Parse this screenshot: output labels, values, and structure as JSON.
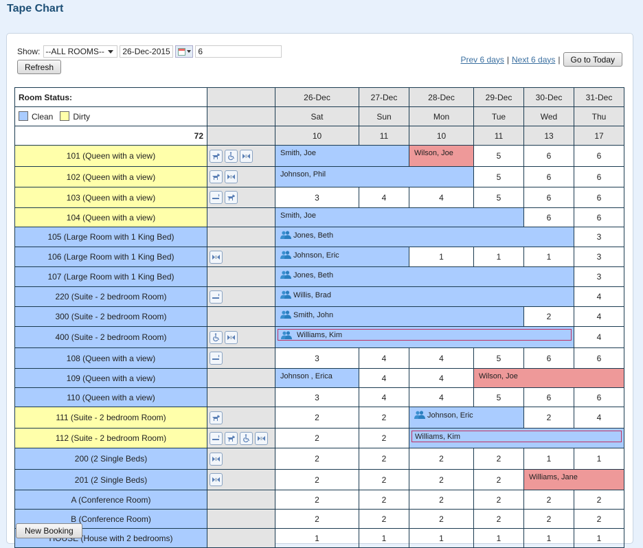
{
  "page": {
    "title": "Tape Chart"
  },
  "controls": {
    "show_label": "Show:",
    "room_filter": "--ALL ROOMS--",
    "start_date": "26-Dec-2015",
    "days": "6",
    "refresh_label": "Refresh",
    "prev_label": "Prev 6 days",
    "next_label": "Next 6 days",
    "separator": "|",
    "today_label": "Go to Today"
  },
  "legend": {
    "room_status_label": "Room Status:",
    "clean_label": "Clean",
    "dirty_label": "Dirty",
    "clean_color": "#aaccff",
    "dirty_color": "#ffffaa",
    "total": "72"
  },
  "days": [
    {
      "date": "26-Dec",
      "dow": "Sat",
      "avail": "10"
    },
    {
      "date": "27-Dec",
      "dow": "Sun",
      "avail": "11"
    },
    {
      "date": "28-Dec",
      "dow": "Mon",
      "avail": "10"
    },
    {
      "date": "29-Dec",
      "dow": "Tue",
      "avail": "11"
    },
    {
      "date": "30-Dec",
      "dow": "Wed",
      "avail": "13"
    },
    {
      "date": "31-Dec",
      "dow": "Thu",
      "avail": "17"
    }
  ],
  "colors": {
    "booking": "#aaccff",
    "booking_alt": "#ee9999",
    "group_frame": "#c03060"
  },
  "rooms": [
    {
      "name": "101 (Queen with a view)",
      "status": "dirty",
      "features": [
        "pet-icon",
        "wheelchair-icon",
        "connecting-icon"
      ],
      "cells": [
        {
          "booking": "Smith, Joe",
          "span": 2
        },
        {
          "booking": "Wilson, Joe",
          "span": 1,
          "red": true
        },
        {
          "value": "5"
        },
        {
          "value": "6"
        },
        {
          "value": "6"
        }
      ]
    },
    {
      "name": "102 (Queen with a view)",
      "status": "dirty",
      "features": [
        "pet-icon",
        "connecting-icon"
      ],
      "cells": [
        {
          "booking": "Johnson, Phil",
          "span": 3
        },
        {
          "value": "5"
        },
        {
          "value": "6"
        },
        {
          "value": "6"
        }
      ]
    },
    {
      "name": "103 (Queen with a view)",
      "status": "dirty",
      "features": [
        "smoking-icon",
        "pet-icon"
      ],
      "cells": [
        {
          "value": "3"
        },
        {
          "value": "4"
        },
        {
          "value": "4"
        },
        {
          "value": "5"
        },
        {
          "value": "6"
        },
        {
          "value": "6"
        }
      ]
    },
    {
      "name": "104 (Queen with a view)",
      "status": "dirty",
      "features": [],
      "cells": [
        {
          "booking": "Smith, Joe",
          "span": 4
        },
        {
          "value": "6"
        },
        {
          "value": "6"
        }
      ]
    },
    {
      "name": "105 (Large Room with 1 King Bed)",
      "status": "clean",
      "features": [],
      "cells": [
        {
          "booking": "Jones, Beth",
          "span": 5,
          "group": true
        },
        {
          "value": "3"
        }
      ]
    },
    {
      "name": "106 (Large Room with 1 King Bed)",
      "status": "clean",
      "features": [
        "connecting-icon"
      ],
      "cells": [
        {
          "booking": "Johnson, Eric",
          "span": 2,
          "group": true
        },
        {
          "value": "1"
        },
        {
          "value": "1"
        },
        {
          "value": "1"
        },
        {
          "value": "3"
        }
      ]
    },
    {
      "name": "107 (Large Room with 1 King Bed)",
      "status": "clean",
      "features": [],
      "cells": [
        {
          "booking": "Jones, Beth",
          "span": 5,
          "group": true
        },
        {
          "value": "3"
        }
      ]
    },
    {
      "name": "220 (Suite - 2 bedroom Room)",
      "status": "clean",
      "features": [
        "smoking-icon"
      ],
      "cells": [
        {
          "booking": "Willis, Brad",
          "span": 5,
          "group": true
        },
        {
          "value": "4"
        }
      ]
    },
    {
      "name": "300 (Suite - 2 bedroom Room)",
      "status": "clean",
      "features": [],
      "cells": [
        {
          "booking": "Smith, John",
          "span": 4,
          "group": true
        },
        {
          "value": "2"
        },
        {
          "value": "4"
        }
      ]
    },
    {
      "name": "400 (Suite - 2 bedroom Room)",
      "status": "clean",
      "features": [
        "wheelchair-icon",
        "connecting-icon"
      ],
      "cells": [
        {
          "booking": "Williams, Kim",
          "span": 5,
          "group": true,
          "framed": true
        },
        {
          "value": "4"
        }
      ]
    },
    {
      "name": "108 (Queen with a view)",
      "status": "clean",
      "features": [
        "smoking-icon"
      ],
      "cells": [
        {
          "value": "3"
        },
        {
          "value": "4"
        },
        {
          "value": "4"
        },
        {
          "value": "5"
        },
        {
          "value": "6"
        },
        {
          "value": "6"
        }
      ]
    },
    {
      "name": "109 (Queen with a view)",
      "status": "clean",
      "features": [],
      "cells": [
        {
          "booking": "Johnson , Erica",
          "span": 1
        },
        {
          "value": "4"
        },
        {
          "value": "4"
        },
        {
          "booking": "Wilson, Joe",
          "span": 3,
          "red": true
        }
      ]
    },
    {
      "name": "110 (Queen with a view)",
      "status": "clean",
      "features": [],
      "cells": [
        {
          "value": "3"
        },
        {
          "value": "4"
        },
        {
          "value": "4"
        },
        {
          "value": "5"
        },
        {
          "value": "6"
        },
        {
          "value": "6"
        }
      ]
    },
    {
      "name": "111 (Suite - 2 bedroom Room)",
      "status": "dirty",
      "features": [
        "pet-icon"
      ],
      "cells": [
        {
          "value": "2"
        },
        {
          "value": "2"
        },
        {
          "booking": "Johnson, Eric",
          "span": 2,
          "group": true
        },
        {
          "value": "2"
        },
        {
          "value": "4"
        }
      ]
    },
    {
      "name": "112 (Suite - 2 bedroom Room)",
      "status": "dirty",
      "features": [
        "smoking-icon",
        "pet-icon",
        "wheelchair-icon",
        "connecting-icon"
      ],
      "cells": [
        {
          "value": "2"
        },
        {
          "value": "2"
        },
        {
          "booking": "Williams, Kim",
          "span": 4,
          "framed": true
        }
      ]
    },
    {
      "name": "200 (2 Single Beds)",
      "status": "clean",
      "features": [
        "connecting-icon"
      ],
      "cells": [
        {
          "value": "2"
        },
        {
          "value": "2"
        },
        {
          "value": "2"
        },
        {
          "value": "2"
        },
        {
          "value": "1"
        },
        {
          "value": "1"
        }
      ]
    },
    {
      "name": "201 (2 Single Beds)",
      "status": "clean",
      "features": [
        "connecting-icon"
      ],
      "cells": [
        {
          "value": "2"
        },
        {
          "value": "2"
        },
        {
          "value": "2"
        },
        {
          "value": "2"
        },
        {
          "booking": "Williams, Jane",
          "span": 2,
          "red": true
        }
      ]
    },
    {
      "name": "A (Conference Room)",
      "status": "clean",
      "features": [],
      "cells": [
        {
          "value": "2"
        },
        {
          "value": "2"
        },
        {
          "value": "2"
        },
        {
          "value": "2"
        },
        {
          "value": "2"
        },
        {
          "value": "2"
        }
      ]
    },
    {
      "name": "B (Conference Room)",
      "status": "clean",
      "features": [],
      "cells": [
        {
          "value": "2"
        },
        {
          "value": "2"
        },
        {
          "value": "2"
        },
        {
          "value": "2"
        },
        {
          "value": "2"
        },
        {
          "value": "2"
        }
      ]
    },
    {
      "name": "HOUSE (House with 2 bedrooms)",
      "status": "clean",
      "features": [],
      "cells": [
        {
          "value": "1"
        },
        {
          "value": "1"
        },
        {
          "value": "1"
        },
        {
          "value": "1"
        },
        {
          "value": "1"
        },
        {
          "value": "1"
        }
      ]
    }
  ],
  "footer": {
    "new_booking_label": "New Booking"
  }
}
